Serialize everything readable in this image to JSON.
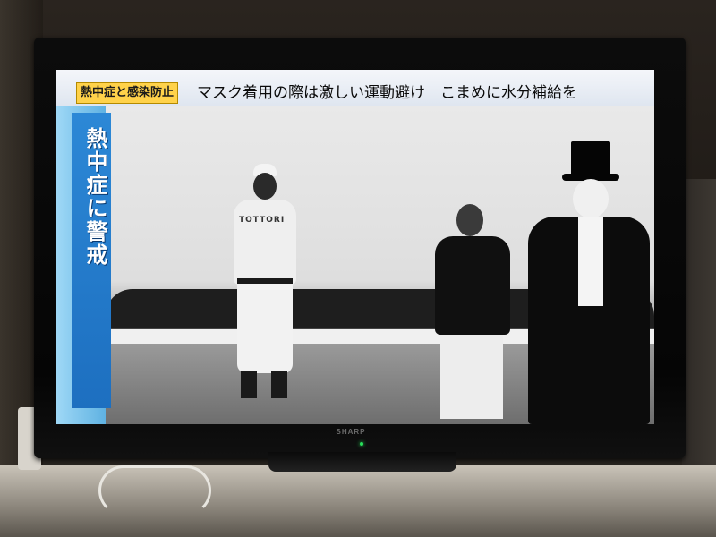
{
  "tv": {
    "brand": "SHARP"
  },
  "broadcast": {
    "topic_tag": "熱中症と感染防止",
    "headline": "マスク着用の際は激しい運動避け　こまめに水分補給を",
    "side_caption": "熱中症に警戒"
  },
  "photo": {
    "uniform_lettering": "TOTTORI"
  },
  "colors": {
    "headline_bg": "#e8eef6",
    "topic_tag_bg": "#ffd24a",
    "side_bar": "#1d6fc0",
    "side_bar_edge": "#9fd8f6",
    "power_led": "#28e05a"
  }
}
